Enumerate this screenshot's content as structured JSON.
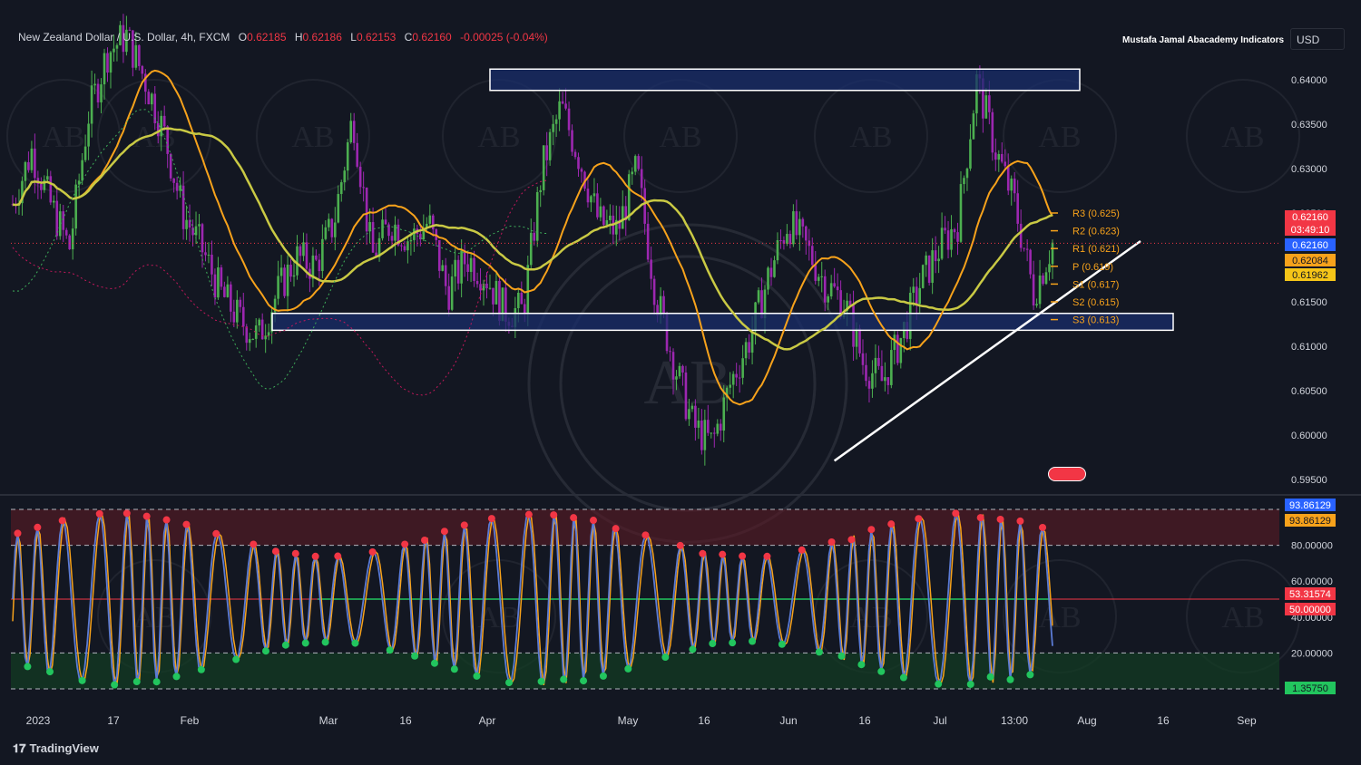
{
  "header": {
    "symbol": "New Zealand Dollar / U.S. Dollar, 4h, FXCM",
    "open_label": "O",
    "open": "0.62185",
    "high_label": "H",
    "high": "0.62186",
    "low_label": "L",
    "low": "0.62153",
    "close_label": "C",
    "close": "0.62160",
    "change": "-0.00025 (-0.04%)"
  },
  "brand_text": "Mustafa Jamal Abacademy Indicators",
  "currency_button": "USD",
  "footer_logo": "TradingView",
  "colors": {
    "background": "#131722",
    "bull": "#4caf50",
    "bear": "#9c27b0",
    "ma_fast": "#f7a21b",
    "ma_slow": "#c9c944",
    "zone_fill": "#1e3a8a",
    "osc_line": "#5b7bd5",
    "osc_signal": "#f7a21b",
    "dot_red": "#f23645",
    "dot_green": "#22c55e"
  },
  "chart_data": [
    {
      "type": "candlestick",
      "x_labels": [
        "2023",
        "17",
        "Feb",
        "Mar",
        "16",
        "Apr",
        "May",
        "16",
        "Jun",
        "16",
        "Jul",
        "13:00",
        "Aug",
        "16",
        "Sep"
      ],
      "y_ticks": [
        "0.64000",
        "0.63500",
        "0.63000",
        "0.62500",
        "0.62000",
        "0.61500",
        "0.61000",
        "0.60500",
        "0.60000",
        "0.59500"
      ],
      "ylim": [
        0.5935,
        0.6445
      ],
      "price_path": [
        0.626,
        0.632,
        0.626,
        0.621,
        0.636,
        0.643,
        0.645,
        0.64,
        0.634,
        0.625,
        0.621,
        0.616,
        0.613,
        0.611,
        0.616,
        0.62,
        0.619,
        0.624,
        0.636,
        0.62,
        0.624,
        0.622,
        0.624,
        0.616,
        0.62,
        0.618,
        0.614,
        0.614,
        0.63,
        0.637,
        0.631,
        0.624,
        0.623,
        0.63,
        0.616,
        0.608,
        0.601,
        0.599,
        0.606,
        0.611,
        0.618,
        0.624,
        0.621,
        0.617,
        0.615,
        0.608,
        0.606,
        0.611,
        0.617,
        0.621,
        0.624,
        0.64,
        0.632,
        0.626,
        0.616,
        0.6216
      ],
      "last_price": "0.62160",
      "countdown": "03:49:10",
      "ma_values": [
        "0.62084",
        "0.61962"
      ],
      "pivots": [
        {
          "label": "R3 (0.625)",
          "value": 0.625
        },
        {
          "label": "R2 (0.623)",
          "value": 0.623
        },
        {
          "label": "R1 (0.621)",
          "value": 0.621
        },
        {
          "label": "P (0.619)",
          "value": 0.619
        },
        {
          "label": "S1 (0.617)",
          "value": 0.617
        },
        {
          "label": "S2 (0.615)",
          "value": 0.615
        },
        {
          "label": "S3 (0.613)",
          "value": 0.613
        }
      ],
      "zones": [
        {
          "name": "resistance",
          "from": 0.6388,
          "to": 0.6412
        },
        {
          "name": "support",
          "from": 0.6118,
          "to": 0.6137
        }
      ],
      "trendline": [
        {
          "x": 0.545,
          "y": 0.5971
        },
        {
          "x": 0.785,
          "y": 0.6216
        }
      ]
    },
    {
      "type": "line",
      "name": "oscillator",
      "y_ticks": [
        "80.00000",
        "60.00000",
        "40.00000",
        "20.00000"
      ],
      "ylim": [
        -3,
        103
      ],
      "levels": [
        100,
        80,
        50,
        20,
        0
      ],
      "labels": {
        "value_a": "93.86129",
        "value_b": "93.86129",
        "mid_a": "53.31574",
        "mid_b": "50.00000",
        "low": "1.35750"
      }
    }
  ]
}
